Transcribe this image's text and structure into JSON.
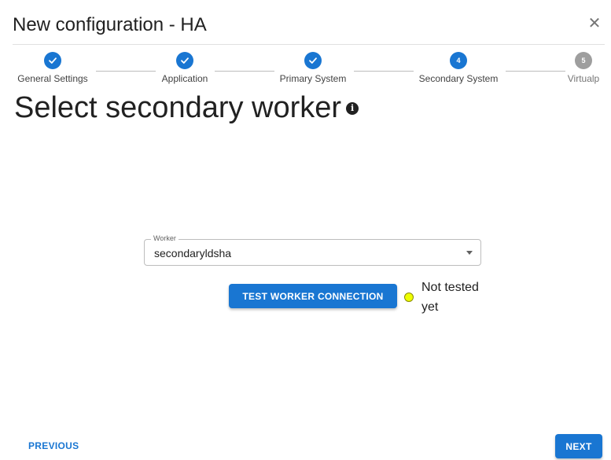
{
  "dialog": {
    "title": "New configuration - HA",
    "close_icon": "close-icon"
  },
  "stepper": {
    "steps": [
      {
        "label": "General Settings",
        "state": "completed",
        "icon": "check-icon"
      },
      {
        "label": "Application",
        "state": "completed",
        "icon": "check-icon"
      },
      {
        "label": "Primary System",
        "state": "completed",
        "icon": "check-icon"
      },
      {
        "label": "Secondary System",
        "state": "active",
        "number": "4"
      },
      {
        "label": "Virtualp",
        "state": "pending",
        "number": "5"
      }
    ]
  },
  "main": {
    "headline": "Select secondary worker",
    "info_icon": "info-icon",
    "worker_field": {
      "label": "Worker",
      "value": "secondaryldsha"
    },
    "test_button_label": "TEST WORKER CONNECTION",
    "connection_status": {
      "text": "Not tested yet",
      "color": "#eeff00"
    }
  },
  "footer": {
    "previous_label": "PREVIOUS",
    "next_label": "NEXT"
  },
  "colors": {
    "accent": "#1976d2",
    "pending_step": "#9e9e9e"
  }
}
